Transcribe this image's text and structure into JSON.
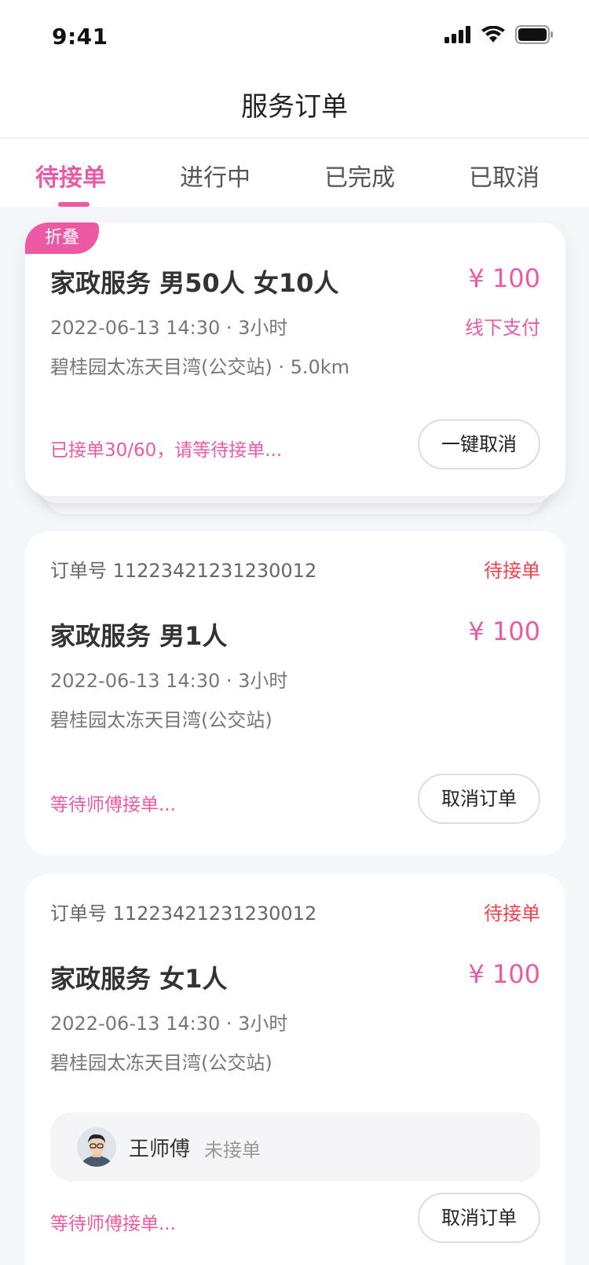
{
  "status_bar": {
    "time": "9:41"
  },
  "nav": {
    "title": "服务订单"
  },
  "tabs": [
    {
      "label": "待接单"
    },
    {
      "label": "进行中"
    },
    {
      "label": "已完成"
    },
    {
      "label": "已取消"
    }
  ],
  "orders": [
    {
      "fold_tag": "折叠",
      "title": "家政服务 男50人 女10人",
      "price": "¥ 100",
      "time": "2022-06-13 14:30 · 3小时",
      "payment": "线下支付",
      "address": "碧桂园太冻天目湾(公交站) · 5.0km",
      "hint": "已接单30/60，请等待接单...",
      "action": "一键取消"
    },
    {
      "order_no": "订单号 11223421231230012",
      "status": "待接单",
      "title": "家政服务 男1人",
      "price": "¥ 100",
      "time": "2022-06-13 14:30 · 3小时",
      "address": "碧桂园太冻天目湾(公交站)",
      "hint": "等待师傅接单...",
      "action": "取消订单"
    },
    {
      "order_no": "订单号 11223421231230012",
      "status": "待接单",
      "title": "家政服务 女1人",
      "price": "¥ 100",
      "time": "2022-06-13 14:30 · 3小时",
      "address": "碧桂园太冻天目湾(公交站)",
      "worker": {
        "name": "王师傅",
        "status": "未接单"
      },
      "hint": "等待师傅接单...",
      "action": "取消订单"
    }
  ],
  "colors": {
    "accent": "#ec5aa3",
    "status_red": "#f0404a"
  }
}
